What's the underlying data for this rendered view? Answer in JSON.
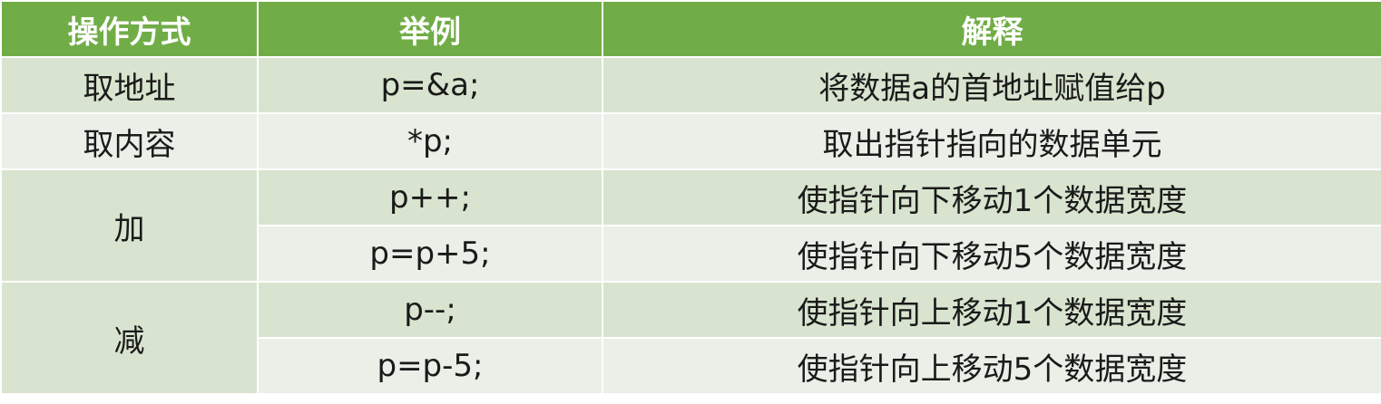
{
  "table": {
    "headers": [
      "操作方式",
      "举例",
      "解释"
    ],
    "rows": [
      {
        "op": "取地址",
        "example": "p=&a;",
        "explain": "将数据a的首地址赋值给p"
      },
      {
        "op": "取内容",
        "example": "*p;",
        "explain": "取出指针指向的数据单元"
      },
      {
        "op": "加",
        "example": "p++;",
        "explain": "使指针向下移动1个数据宽度"
      },
      {
        "op": "",
        "example": "p=p+5;",
        "explain": "使指针向下移动5个数据宽度"
      },
      {
        "op": "减",
        "example": "p--;",
        "explain": "使指针向上移动1个数据宽度"
      },
      {
        "op": "",
        "example": "p=p-5;",
        "explain": "使指针向上移动5个数据宽度"
      }
    ]
  },
  "colors": {
    "header_bg": "#70ad47",
    "row_band_dark": "#d8e4cf",
    "row_band_light": "#eaefe7",
    "header_text": "#ffffff"
  }
}
